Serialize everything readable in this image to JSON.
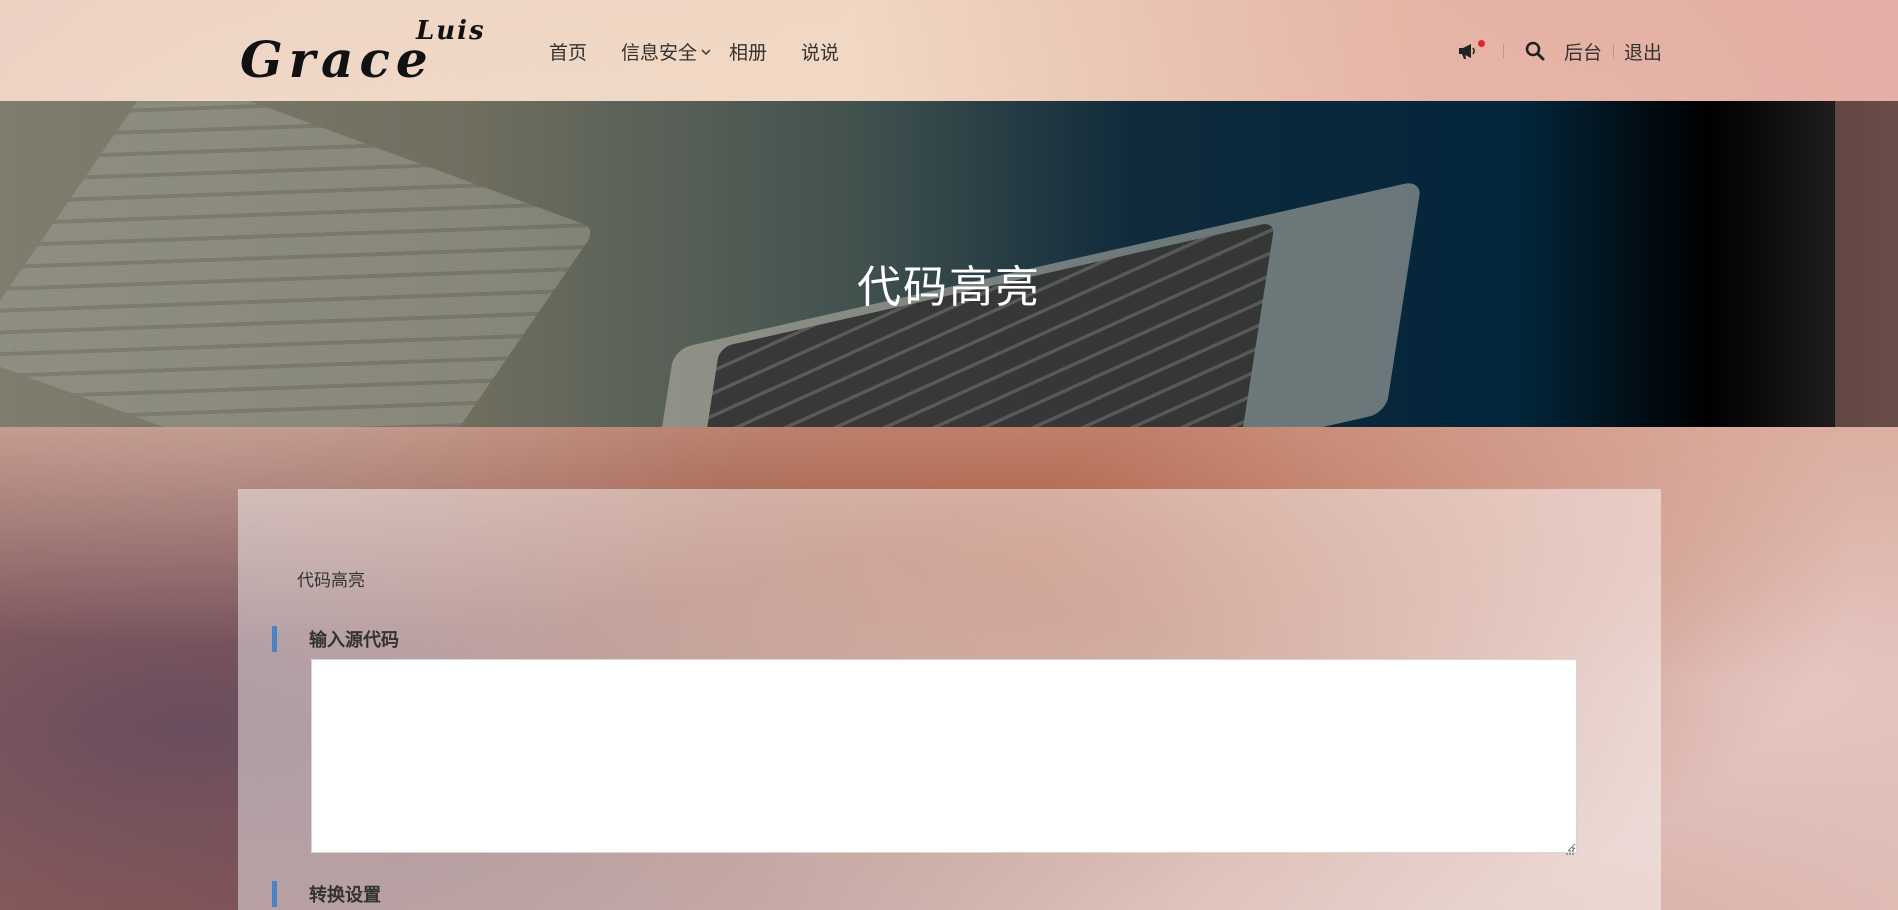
{
  "header": {
    "logo": {
      "main": "Grace",
      "sup": "Luis"
    },
    "nav": [
      {
        "label": "首页"
      },
      {
        "label": "信息安全",
        "has_submenu": true
      },
      {
        "label": "相册"
      },
      {
        "label": "说说"
      }
    ],
    "right": {
      "admin_label": "后台",
      "logout_label": "退出"
    }
  },
  "banner": {
    "title": "代码高亮"
  },
  "content": {
    "breadcrumb": "代码高亮",
    "sections": [
      {
        "label": "输入源代码"
      },
      {
        "label": "转换设置"
      }
    ],
    "code_input": {
      "value": "",
      "placeholder": ""
    }
  },
  "colors": {
    "section_bar": "#4a82c3",
    "notification_dot": "#e0262b",
    "banner_title": "#ffffff"
  },
  "icons": {
    "notification": "megaphone-icon",
    "search": "search-icon",
    "dropdown": "chevron-down-icon"
  }
}
